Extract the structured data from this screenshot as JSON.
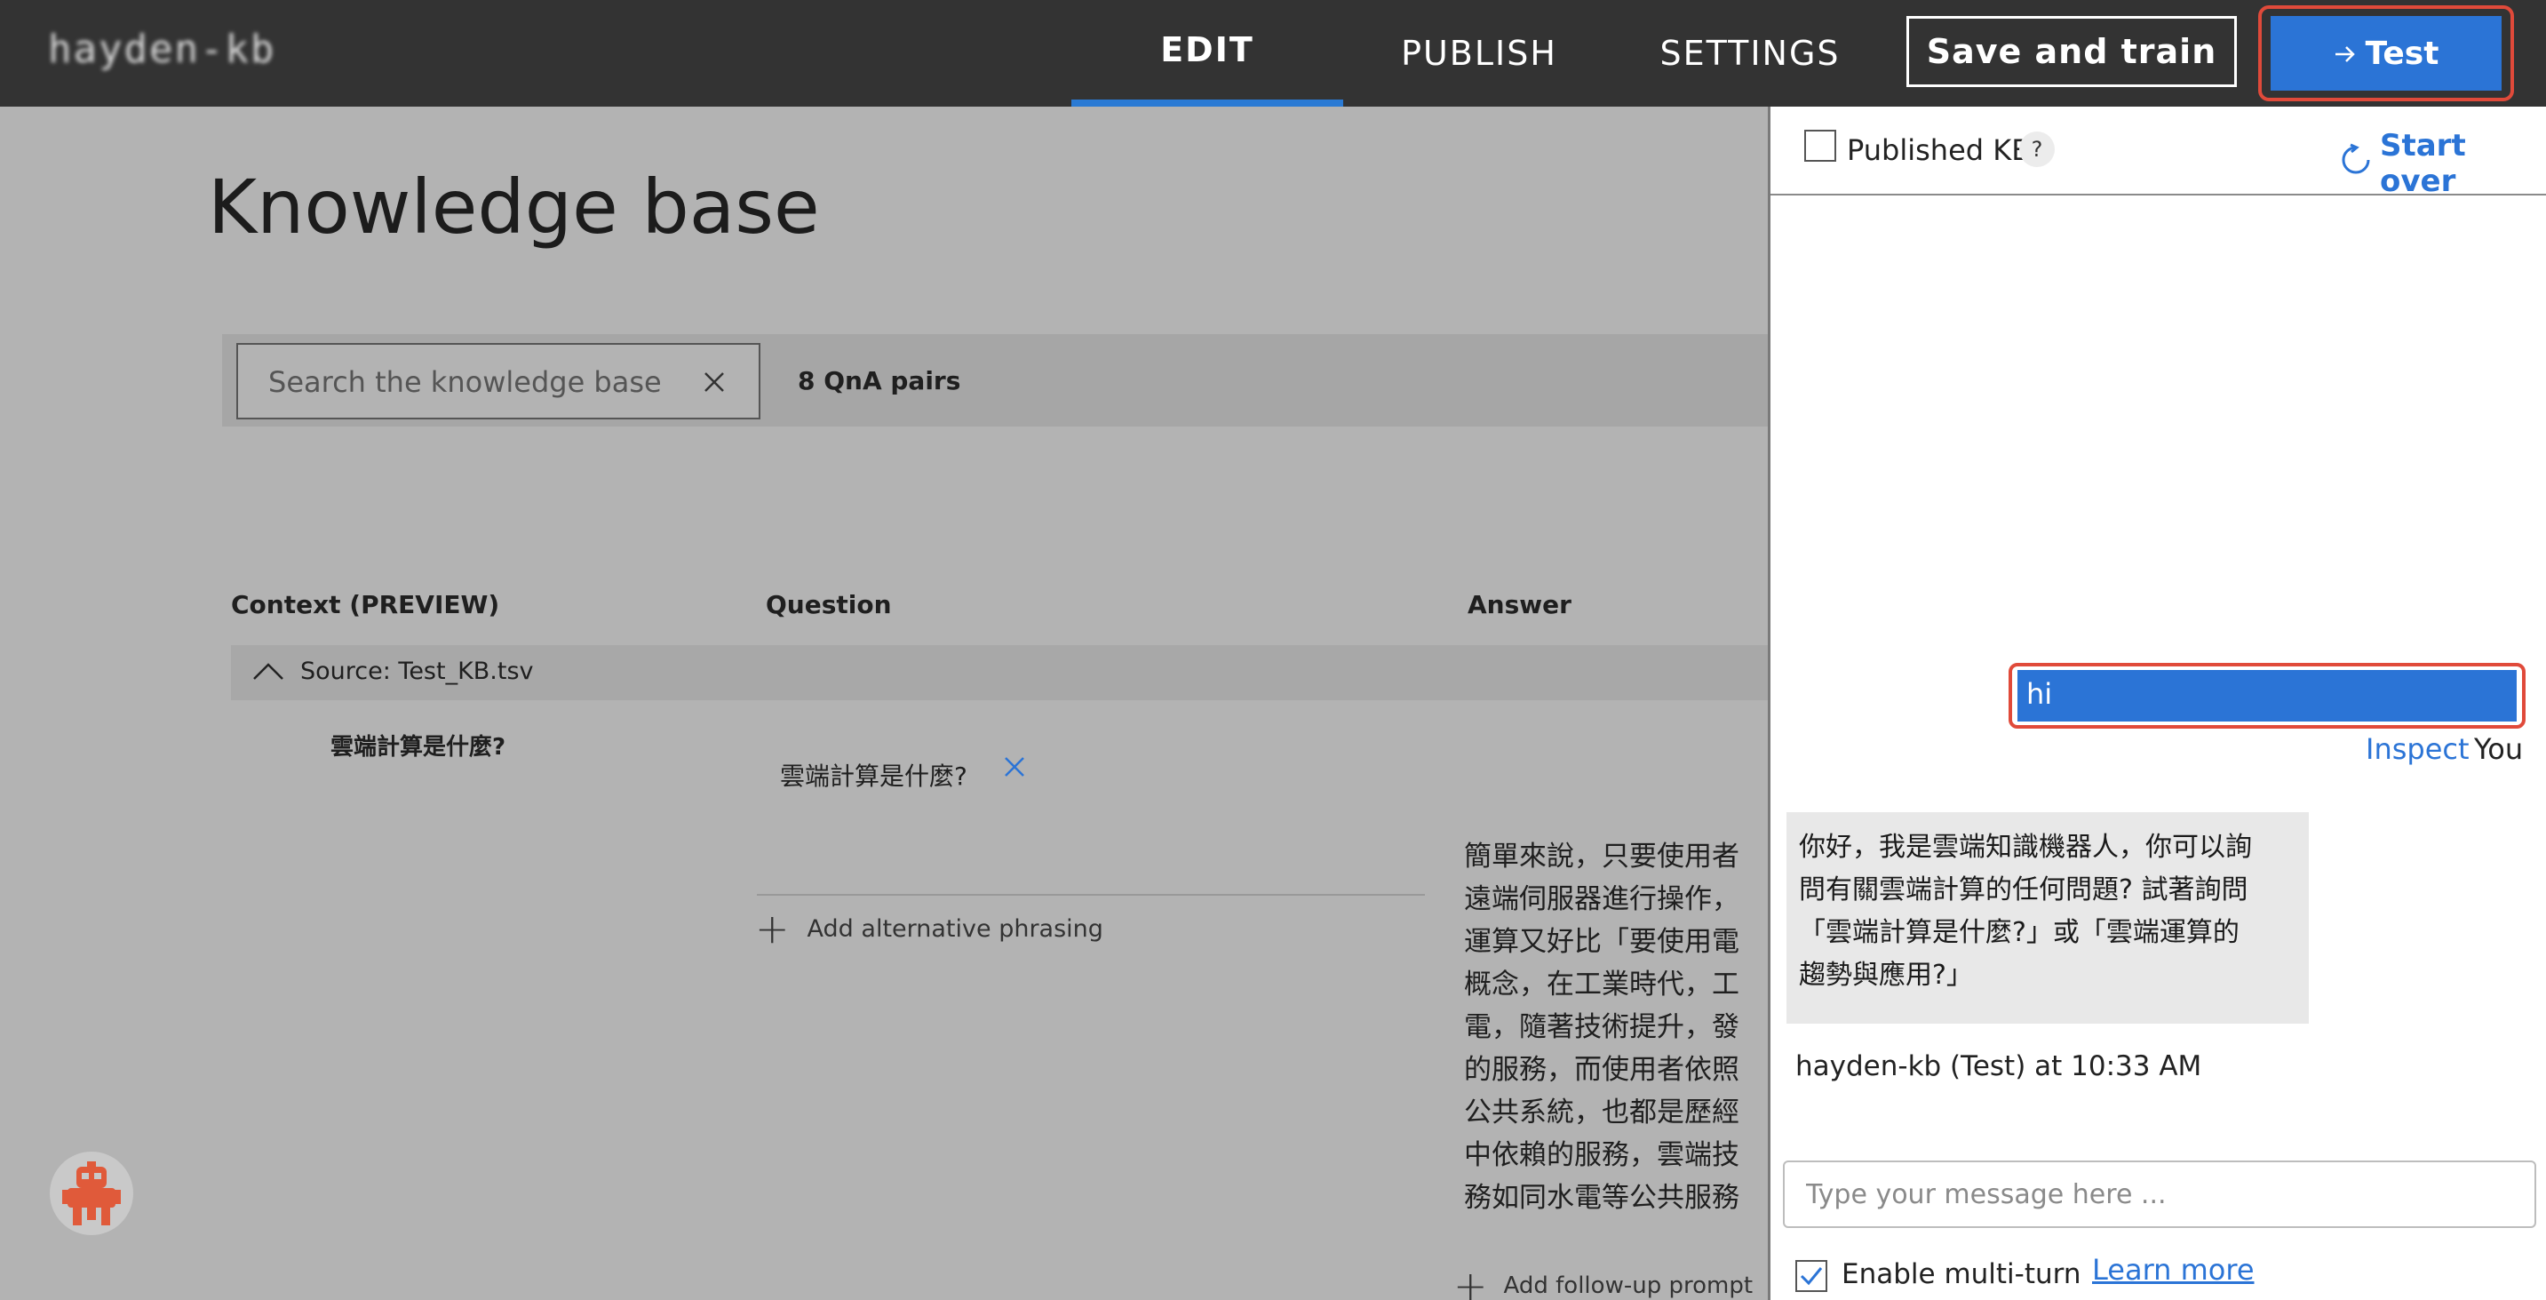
{
  "app": {
    "brand": "hayden-kb"
  },
  "nav": {
    "edit": "EDIT",
    "publish": "PUBLISH",
    "settings": "SETTINGS",
    "active": "EDIT"
  },
  "toolbar": {
    "save_label": "Save and train",
    "test_label": "Test",
    "test_icon": "arrow-right-icon"
  },
  "main": {
    "title": "Knowledge base",
    "search": {
      "placeholder": "Search the knowledge base",
      "value": ""
    },
    "qna_count": "8 QnA pairs",
    "columns": [
      "Context (PREVIEW)",
      "Question",
      "Answer"
    ],
    "source": "Source: Test_KB.tsv",
    "rows": [
      {
        "context": "雲端計算是什麼?",
        "questions": [
          "雲端計算是什麼?"
        ],
        "add_alternative": "Add alternative phrasing",
        "answer_lines": [
          "簡單來說，只要使用者",
          "遠端伺服器進行操作，",
          "運算又好比「要使用電",
          "概念，在工業時代，工",
          "電，隨著技術提升，發",
          "的服務，而使用者依照",
          "公共系統，也都是歷經",
          "中依賴的服務，雲端技",
          "務如同水電等公共服務"
        ],
        "add_followup": "Add follow-up prompt"
      }
    ]
  },
  "test_panel": {
    "published_kb_label": "Published KB",
    "published_kb_checked": false,
    "help_label": "?",
    "start_over_label": "Start over",
    "user_message": "hi",
    "inspect_label": "Inspect",
    "user_sender": "You",
    "bot_message_lines": [
      "你好，我是雲端知識機器人，你可以詢",
      "問有關雲端計算的任何問題? 試著詢問",
      "「雲端計算是什麼?」或「雲端運算的",
      "趨勢與應用?」"
    ],
    "bot_meta": "hayden-kb (Test) at 10:33 AM",
    "input_placeholder": "Type your message here ...",
    "multi_turn_label": "Enable multi-turn",
    "multi_turn_checked": true,
    "learn_more_label": "Learn more"
  },
  "colors": {
    "accent": "#2b74d6",
    "highlight": "#e04a3a",
    "topbar": "#333333",
    "overlay": "#b3b3b3"
  }
}
